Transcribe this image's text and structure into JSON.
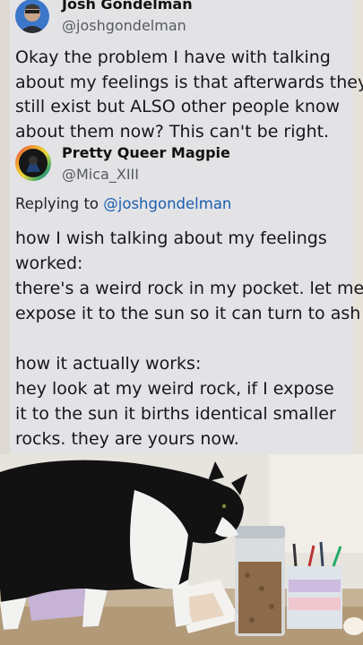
{
  "original_tweet": {
    "author_name": "Josh Gondelman",
    "author_handle": "@joshgondelman",
    "text_lines": [
      "Okay the problem I have with talking",
      "about my feelings is that afterwards they",
      "still exist but ALSO other people know",
      "about them now? This can't be right."
    ]
  },
  "reply_tweet": {
    "author_name": "Pretty Queer Magpie",
    "author_handle": "@Mica_XIII",
    "replying_prefix": "Replying to",
    "replying_handle": "@joshgondelman",
    "text_lines": [
      "how I wish talking about my feelings",
      "worked:",
      "there's a weird rock in my pocket. let me",
      "expose it to the sun so it can turn to ash",
      "",
      "how it actually works:",
      "hey look at my weird rock, if I expose",
      "it to the sun it births identical smaller",
      "rocks. they are yours now."
    ]
  },
  "colors": {
    "card_background": "#e3e3e6",
    "link_blue": "#1a5fb0"
  }
}
